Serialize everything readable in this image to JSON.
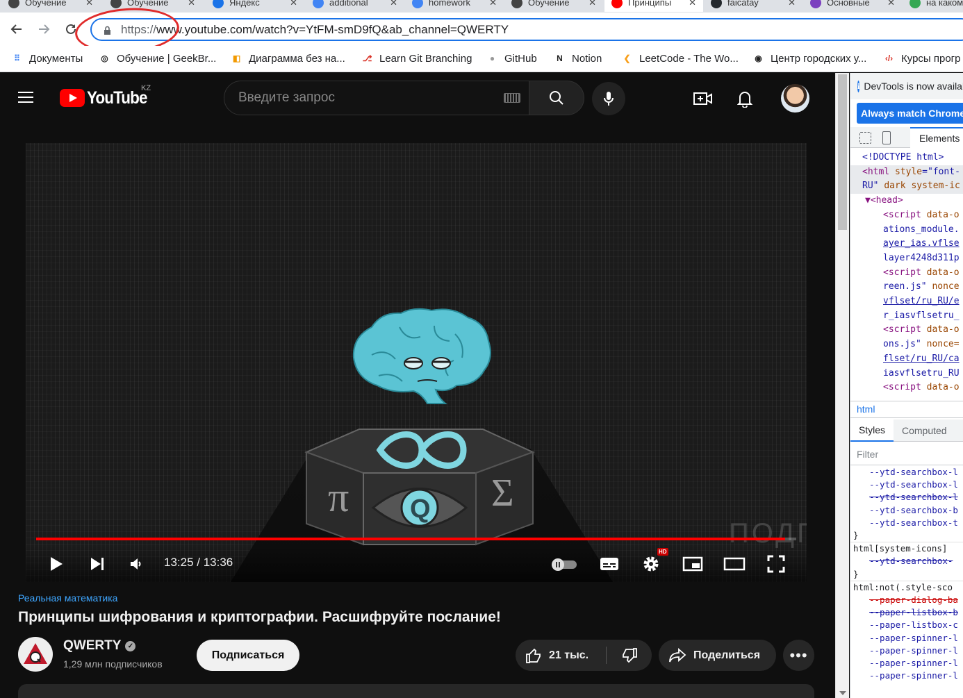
{
  "browser": {
    "tabs": [
      {
        "label": "Обучение",
        "icon_color": "#444444"
      },
      {
        "label": "Обучение",
        "icon_color": "#444444"
      },
      {
        "label": "Яндекс",
        "icon_color": "#1a73e8"
      },
      {
        "label": "additional",
        "icon_color": "#4285f4"
      },
      {
        "label": "homework",
        "icon_color": "#4285f4"
      },
      {
        "label": "Обучение",
        "icon_color": "#444444"
      },
      {
        "label": "Принципы",
        "icon_color": "#ff0000"
      },
      {
        "label": "faicatay",
        "icon_color": "#24292e"
      },
      {
        "label": "Основные",
        "icon_color": "#7b3fbf"
      },
      {
        "label": "на каком",
        "icon_color": "#34a853"
      }
    ],
    "url_scheme": "https://",
    "url_rest": "www.youtube.com/watch?v=YtFM-smD9fQ&ab_channel=QWERTY",
    "bookmarks": [
      {
        "label": "Документы",
        "icon": "apps-grid-icon"
      },
      {
        "label": "Обучение | GeekBr...",
        "icon": "geekbrains-icon"
      },
      {
        "label": "Диаграмма без на...",
        "icon": "diagram-icon"
      },
      {
        "label": "Learn Git Branching",
        "icon": "git-branching-icon"
      },
      {
        "label": "GitHub",
        "icon": "github-icon"
      },
      {
        "label": "Notion",
        "icon": "notion-icon"
      },
      {
        "label": "LeetCode - The Wo...",
        "icon": "leetcode-icon"
      },
      {
        "label": "Центр городских у...",
        "icon": "globe-icon"
      },
      {
        "label": "Курсы прогр",
        "icon": "code-icon"
      }
    ]
  },
  "youtube": {
    "logo_text": "YouTube",
    "region": "KZ",
    "search_placeholder": "Введите запрос",
    "player": {
      "time": "13:25 / 13:36",
      "progress_fraction": 0.985,
      "hd_badge": "HD",
      "watermark": "ПОДПИ"
    },
    "video": {
      "channel_tag": "Реальная математика",
      "title": "Принципы шифрования и криптографии. Расшифруйте послание!",
      "channel_name": "QWERTY",
      "verified_mark": "✓",
      "subscribers": "1,29 млн подписчиков",
      "subscribe_label": "Подписаться",
      "likes": "21 тыс.",
      "share_label": "Поделиться",
      "more_label": "•••"
    }
  },
  "devtools": {
    "info_text": "DevTools is now available in Russian",
    "match_button": "Always match Chrome's language",
    "tab_elements": "Elements",
    "dom_lines": [
      {
        "html": "&lt;!DOCTYPE html&gt;",
        "indent": 17,
        "hl": false
      },
      {
        "html": "<span class='tag'>&lt;html </span><span class='attr'>style</span>=<span class='str'>\"font-</span>",
        "indent": 17,
        "hl": true
      },
      {
        "html": "<span class='str'>RU\"</span> <span class='attr'>dark system-ic</span>",
        "indent": 17,
        "hl": true
      },
      {
        "html": "<span class='tag'>▼&lt;head&gt;</span>",
        "indent": 21,
        "hl": false
      },
      {
        "html": "<span class='tag'>&lt;script </span><span class='attr'>data-o</span>",
        "indent": 47,
        "hl": false
      },
      {
        "html": "<span class='str'>ations_module.</span>",
        "indent": 47,
        "hl": false
      },
      {
        "html": "<span class='link'>ayer_ias.vflse</span>",
        "indent": 47,
        "hl": false
      },
      {
        "html": "<span class='str'>layer4248d311p</span>",
        "indent": 47,
        "hl": false
      },
      {
        "html": "<span class='tag'>&lt;script </span><span class='attr'>data-o</span>",
        "indent": 47,
        "hl": false
      },
      {
        "html": "<span class='str'>reen.js\"</span> <span class='attr'>nonce</span>",
        "indent": 47,
        "hl": false
      },
      {
        "html": "<span class='link'>vflset/ru_RU/e</span>",
        "indent": 47,
        "hl": false
      },
      {
        "html": "<span class='str'>r_iasvflsetru_</span>",
        "indent": 47,
        "hl": false
      },
      {
        "html": "<span class='tag'>&lt;script </span><span class='attr'>data-o</span>",
        "indent": 47,
        "hl": false
      },
      {
        "html": "<span class='str'>ons.js\"</span> <span class='attr'>nonce=</span>",
        "indent": 47,
        "hl": false
      },
      {
        "html": "<span class='link'>flset/ru_RU/ca</span>",
        "indent": 47,
        "hl": false
      },
      {
        "html": "<span class='str'>iasvflsetru_RU</span>",
        "indent": 47,
        "hl": false
      },
      {
        "html": "<span class='tag'>&lt;script </span><span class='attr'>data-o</span>",
        "indent": 47,
        "hl": false
      }
    ],
    "breadcrumb": "html",
    "styles_tab": "Styles",
    "computed_tab": "Computed",
    "filter_placeholder": "Filter",
    "css_lines": [
      {
        "text": "--ytd-searchbox-l",
        "kind": "prop"
      },
      {
        "text": "--ytd-searchbox-l",
        "kind": "prop"
      },
      {
        "text": "--ytd-searchbox-l",
        "kind": "struck-blue"
      },
      {
        "text": "--ytd-searchbox-b",
        "kind": "prop"
      },
      {
        "text": "--ytd-searchbox-t",
        "kind": "prop"
      },
      {
        "text": "}",
        "kind": "brace"
      },
      {
        "text": "html[system-icons]",
        "kind": "sel-sep"
      },
      {
        "text": "--ytd-searchbox-",
        "kind": "struck-blue"
      },
      {
        "text": "}",
        "kind": "brace"
      },
      {
        "text": "html:not(.style-sco",
        "kind": "sel-sep"
      },
      {
        "text": "--paper-dialog-ba",
        "kind": "struck"
      },
      {
        "text": "--paper-listbox-b",
        "kind": "struck-blue"
      },
      {
        "text": "--paper-listbox-c",
        "kind": "prop"
      },
      {
        "text": "--paper-spinner-l",
        "kind": "prop"
      },
      {
        "text": "--paper-spinner-l",
        "kind": "prop"
      },
      {
        "text": "--paper-spinner-l",
        "kind": "prop"
      },
      {
        "text": "--paper-spinner-l",
        "kind": "prop"
      }
    ]
  }
}
